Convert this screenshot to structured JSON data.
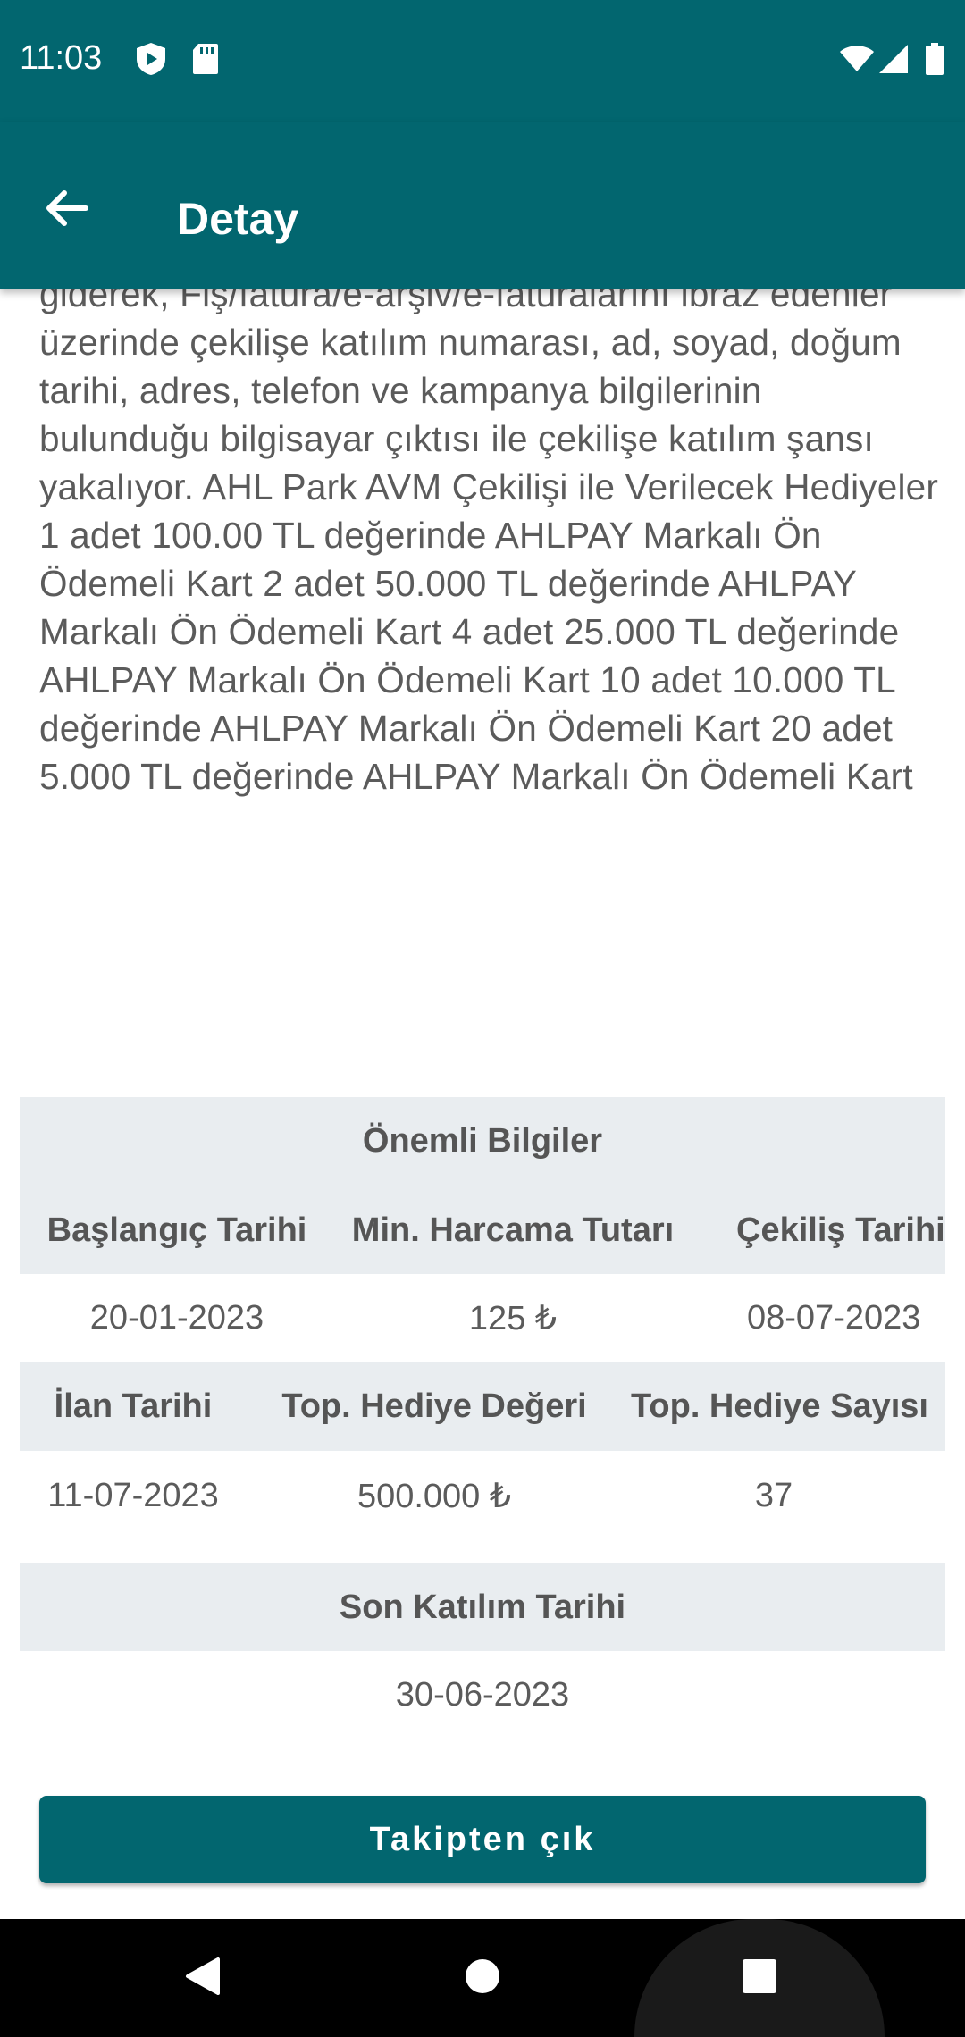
{
  "status_bar": {
    "time": "11:03",
    "left_icons": [
      "play-protect-icon",
      "sd-card-icon"
    ],
    "right_icons": [
      "wifi-icon",
      "signal-icon",
      "battery-icon"
    ]
  },
  "app_bar": {
    "title": "Detay",
    "back_icon": "arrow-left-icon"
  },
  "description": "giderek, Fiş/fatura/e-arşiv/e-faturalarını ibraz edenler üzerinde çekilişe katılım numarası, ad, soyad, doğum tarihi, adres, telefon ve kampanya bilgilerinin bulunduğu bilgisayar çıktısı ile çekilişe katılım şansı yakalıyor. AHL Park AVM Çekilişi ile Verilecek Hediyeler 1 adet 100.00 TL değerinde AHLPAY Markalı Ön Ödemeli Kart 2 adet 50.000 TL değerinde AHLPAY Markalı Ön Ödemeli Kart 4 adet 25.000 TL değerinde AHLPAY Markalı Ön Ödemeli Kart 10 adet 10.000 TL değerinde AHLPAY Markalı Ön Ödemeli Kart 20 adet 5.000 TL değerinde AHLPAY Markalı Ön Ödemeli Kart",
  "info": {
    "title": "Önemli Bilgiler",
    "row1_headers": [
      "Başlangıç Tarihi",
      "Min. Harcama Tutarı",
      "Çekiliş Tarihi"
    ],
    "row1_values": [
      "20-01-2023",
      "125 ₺",
      "08-07-2023"
    ],
    "row2_headers": [
      "İlan Tarihi",
      "Top. Hediye Değeri",
      "Top. Hediye Sayısı"
    ],
    "row2_values": [
      "11-07-2023",
      "500.000 ₺",
      "37"
    ],
    "row3_header": "Son Katılım Tarihi",
    "row3_value": "30-06-2023"
  },
  "button": {
    "label": "Takipten çık"
  },
  "nav_bar": {
    "icons": [
      "back-triangle-icon",
      "home-circle-icon",
      "recents-square-icon"
    ]
  },
  "colors": {
    "primary": "#02666f",
    "header_bg": "#e9edf0",
    "text": "#5b5b5b"
  }
}
